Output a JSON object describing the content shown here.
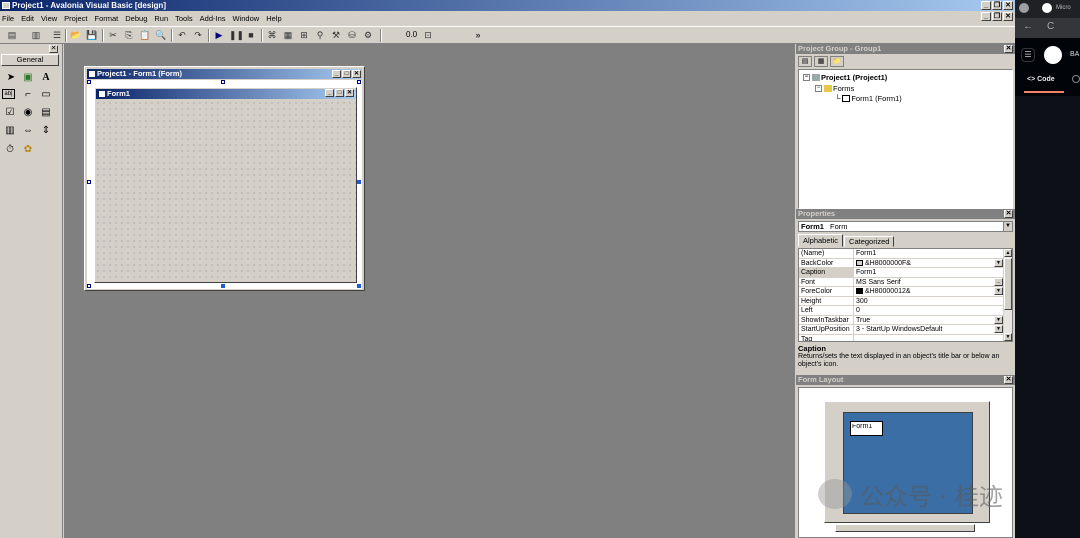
{
  "window": {
    "title": "Project1 - Avalonia Visual Basic [design]",
    "controls": [
      "_",
      "❐",
      "✕"
    ]
  },
  "menu": {
    "items": [
      "File",
      "Edit",
      "View",
      "Project",
      "Format",
      "Debug",
      "Run",
      "Tools",
      "Add-Ins",
      "Window",
      "Help"
    ],
    "mdi_controls": [
      "_",
      "❐",
      "✕"
    ]
  },
  "toolbar": {
    "zoom": "0.0",
    "overflow": "»"
  },
  "toolbox": {
    "close": "✕",
    "tab_label": "General"
  },
  "designer": {
    "title": "Project1 - Form1 (Form)",
    "controls": [
      "_",
      "□",
      "✕"
    ],
    "form_title": "Form1",
    "form_controls": [
      "_",
      "□",
      "✕"
    ]
  },
  "project_pane": {
    "title": "Project Group - Group1",
    "close": "✕",
    "tree": {
      "root": "Project1 (Project1)",
      "folder": "Forms",
      "leaf": "Form1 (Form1)"
    }
  },
  "properties_pane": {
    "title": "Properties",
    "close": "✕",
    "object_name": "Form1",
    "object_type": "Form",
    "tabs": [
      "Alphabetic",
      "Categorized"
    ],
    "rows": [
      {
        "name": "(Name)",
        "value": "Form1",
        "swatch": null,
        "button": null
      },
      {
        "name": "BackColor",
        "value": "&H8000000F&",
        "swatch": "#d4d0c8",
        "button": "▼"
      },
      {
        "name": "Caption",
        "value": "Form1",
        "swatch": null,
        "button": null
      },
      {
        "name": "Font",
        "value": "MS Sans Serif",
        "swatch": null,
        "button": "..."
      },
      {
        "name": "ForeColor",
        "value": "&H80000012&",
        "swatch": "#000000",
        "button": "▼"
      },
      {
        "name": "Height",
        "value": "300",
        "swatch": null,
        "button": null
      },
      {
        "name": "Left",
        "value": "0",
        "swatch": null,
        "button": null
      },
      {
        "name": "ShowInTaskbar",
        "value": "True",
        "swatch": null,
        "button": "▼"
      },
      {
        "name": "StartUpPosition",
        "value": "3 - StartUp WindowsDefault",
        "swatch": null,
        "button": "▼"
      },
      {
        "name": "Tag",
        "value": "",
        "swatch": null,
        "button": null
      }
    ],
    "description_title": "Caption",
    "description_text": "Returns/sets the text displayed in an object's title bar or below an object's icon."
  },
  "layout_pane": {
    "title": "Form Layout",
    "close": "✕",
    "form_label": "Form1"
  },
  "watermark": {
    "text": "公众号 · 桂迹"
  },
  "browser": {
    "tab_label": "Micro",
    "brand": "BA",
    "code_tab": "Code",
    "hamburger": "☰",
    "back": "←",
    "reload": "C"
  },
  "colors": {
    "title_active": "#0a246a",
    "workspace": "#808080",
    "face": "#d4d0c8",
    "screen": "#3a6ea5"
  }
}
